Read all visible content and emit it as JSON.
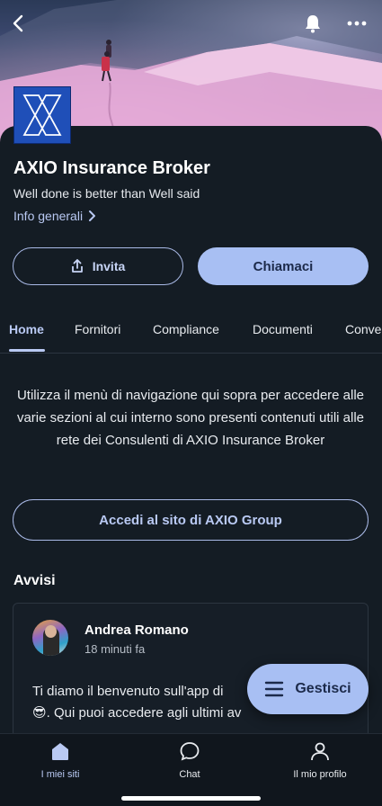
{
  "header": {
    "icons": [
      "back-icon",
      "bell-icon",
      "more-icon"
    ]
  },
  "profile": {
    "logo_icon": "axio-logo-icon",
    "name": "AXIO Insurance Broker",
    "tagline": "Well done is better than Well said",
    "info_link": "Info generali"
  },
  "actions": {
    "invite_label": "Invita",
    "call_label": "Chiamaci"
  },
  "tabs": [
    {
      "label": "Home",
      "active": true
    },
    {
      "label": "Fornitori",
      "active": false
    },
    {
      "label": "Compliance",
      "active": false
    },
    {
      "label": "Documenti",
      "active": false
    },
    {
      "label": "Conve",
      "active": false
    }
  ],
  "home": {
    "intro_text": "Utilizza il menù di navigazione qui sopra per accedere alle varie sezioni al cui interno sono presenti contenuti utili alle rete dei Consulenti di AXIO Insurance Broker",
    "site_button": "Accedi al sito di AXIO Group"
  },
  "announcements": {
    "title": "Avvisi",
    "posts": [
      {
        "author": "Andrea Romano",
        "time": "18 minuti fa",
        "text_line1": "Ti diamo il benvenuto sull'app di",
        "text_line2_emoji": "😎",
        "text_line2": ". Qui puoi accedere agli ultimi av"
      }
    ]
  },
  "fab": {
    "label": "Gestisci",
    "icon": "menu-icon"
  },
  "bottom_nav": [
    {
      "label": "I miei siti",
      "icon": "home-icon",
      "active": true
    },
    {
      "label": "Chat",
      "icon": "chat-icon",
      "active": false
    },
    {
      "label": "Il mio profilo",
      "icon": "user-icon",
      "active": false
    }
  ],
  "colors": {
    "background": "#141c24",
    "accent": "#a8bff3",
    "link": "#b9c9f3"
  }
}
